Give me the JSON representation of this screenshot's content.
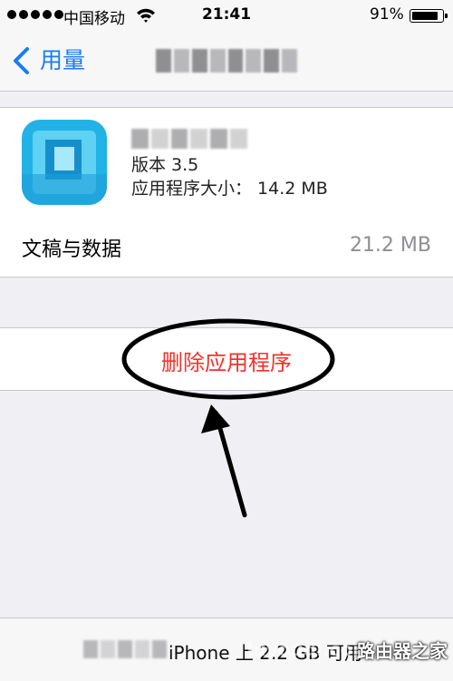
{
  "status_bar": {
    "carrier": "中国移动",
    "time": "21:41",
    "battery_percent": "91%",
    "battery_level": 0.91,
    "signal_icon": "signal-dots-icon",
    "wifi_icon": "wifi-icon",
    "battery_icon": "battery-icon"
  },
  "nav": {
    "back_label": "用量",
    "back_icon": "chevron-left-icon"
  },
  "app": {
    "version": "版本 3.5",
    "size": "应用程序大小：  14.2 MB"
  },
  "documents": {
    "label": "文稿与数据",
    "value": "21.2 MB"
  },
  "delete": {
    "label": "删除应用程序"
  },
  "footer": {
    "storage": "iPhone 上 2.2 GB 可用",
    "watermark": "路由器之家",
    "watermark_url": "luyouqi.com"
  },
  "colors": {
    "accent": "#1a7cf5",
    "destructive": "#f2322c",
    "background": "#efeff4"
  }
}
